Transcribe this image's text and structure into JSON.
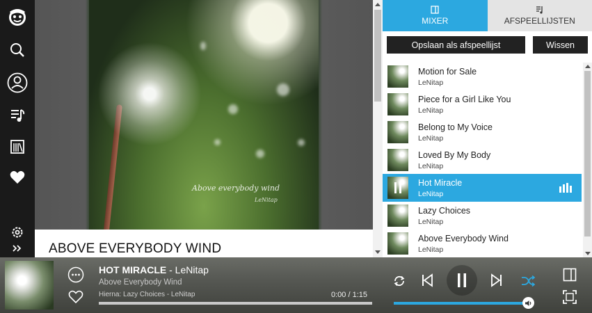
{
  "app": {
    "accent": "#2ca8e0",
    "nav_bg": "#1a1a1a"
  },
  "nav": {
    "items": [
      {
        "icon": "napster-logo-icon"
      },
      {
        "icon": "search-icon"
      },
      {
        "icon": "profile-icon"
      },
      {
        "icon": "music-library-icon"
      },
      {
        "icon": "radio-icon"
      },
      {
        "icon": "heart-icon"
      },
      {
        "icon": "gear-icon"
      },
      {
        "icon": "expand-chevrons-icon"
      }
    ]
  },
  "album": {
    "title": "ABOVE EVERYBODY WIND",
    "art_caption": "Above everybody wind",
    "art_caption_artist": "LeNitap"
  },
  "panel": {
    "tabs": [
      {
        "label": "MIXER",
        "icon": "mixer-icon",
        "active": true
      },
      {
        "label": "AFSPEELLIJSTEN",
        "icon": "playlist-icon",
        "active": false
      }
    ],
    "save_label": "Opslaan als afspeellijst",
    "clear_label": "Wissen",
    "tracks": [
      {
        "title": "Motion for Sale",
        "artist": "LeNitap",
        "active": false
      },
      {
        "title": "Piece for a Girl Like You",
        "artist": "LeNitap",
        "active": false
      },
      {
        "title": "Belong to My Voice",
        "artist": "LeNitap",
        "active": false
      },
      {
        "title": "Loved By My Body",
        "artist": "LeNitap",
        "active": false
      },
      {
        "title": "Hot Miracle",
        "artist": "LeNitap",
        "active": true
      },
      {
        "title": "Lazy Choices",
        "artist": "LeNitap",
        "active": false
      },
      {
        "title": "Above Everybody Wind",
        "artist": "LeNitap",
        "active": false
      }
    ]
  },
  "player": {
    "song_title": "HOT MIRACLE",
    "song_artist": " - LeNitap",
    "album": "Above Everybody Wind",
    "next_up": "Hierna: Lazy Choices - LeNitap",
    "time": "0:00 / 1:15",
    "progress": 0.0,
    "volume": 1.0
  }
}
